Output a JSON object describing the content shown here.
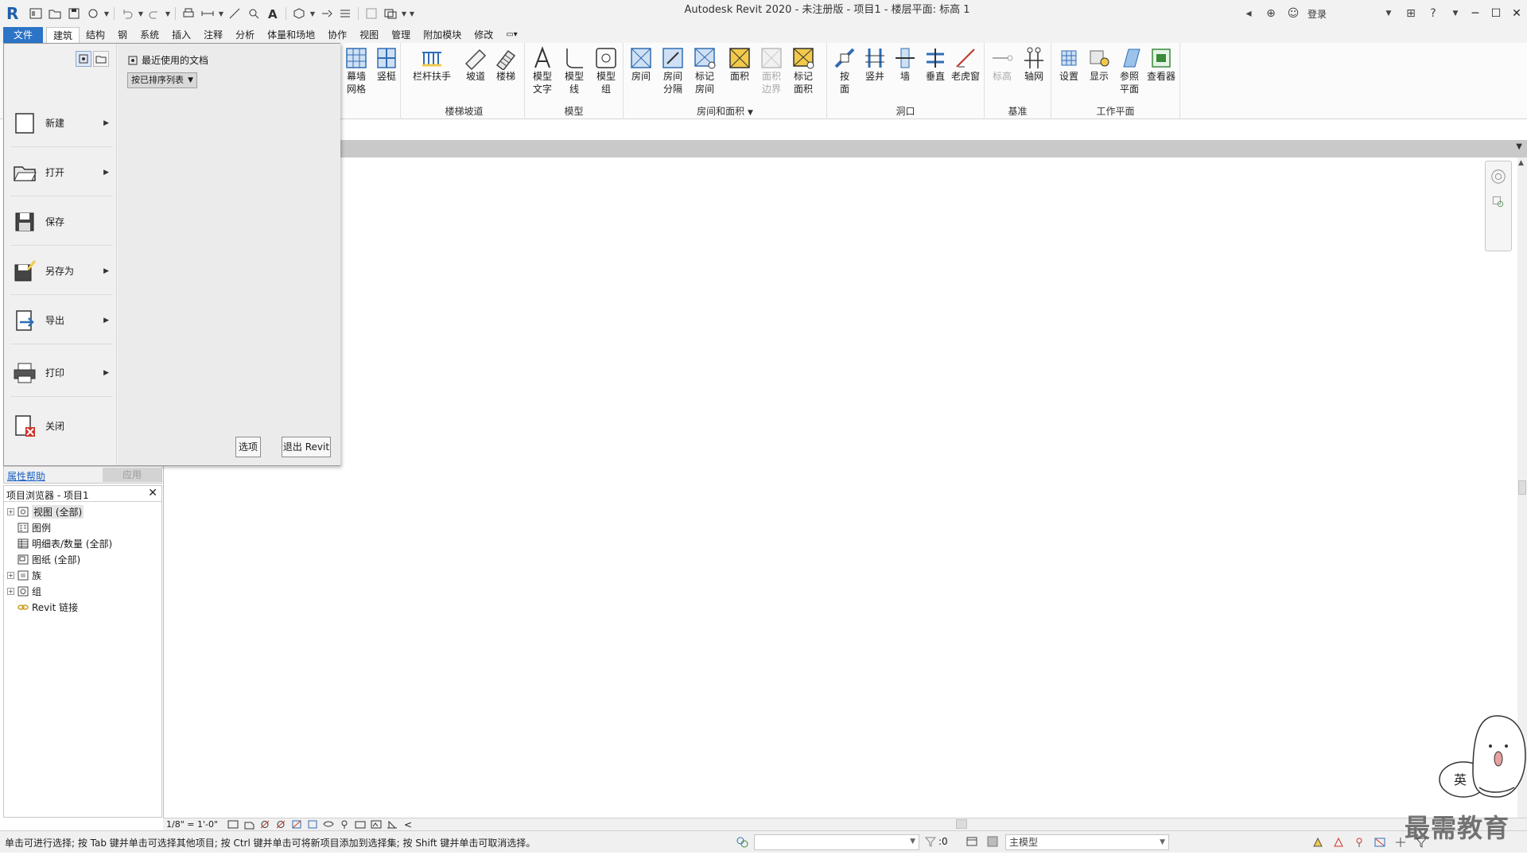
{
  "window": {
    "title": "Autodesk Revit 2020 - 未注册版 - 项目1 - 楼层平面: 标高 1"
  },
  "app_logo": "R",
  "title_right": {
    "sign_in": "登录"
  },
  "tabs": [
    {
      "label": "文件",
      "kind": "file"
    },
    {
      "label": "建筑",
      "kind": "active"
    },
    {
      "label": "结构"
    },
    {
      "label": "钢"
    },
    {
      "label": "系统"
    },
    {
      "label": "插入"
    },
    {
      "label": "注释"
    },
    {
      "label": "分析"
    },
    {
      "label": "体量和场地"
    },
    {
      "label": "协作"
    },
    {
      "label": "视图"
    },
    {
      "label": "管理"
    },
    {
      "label": "附加模块"
    },
    {
      "label": "修改"
    }
  ],
  "ribbon": {
    "curtain": {
      "grid": "幕墙\n网格",
      "mullion": "竖梃"
    },
    "stairs": {
      "label": "楼梯坡道",
      "railing": "栏杆扶手",
      "ramp": "坡道",
      "stair": "楼梯"
    },
    "model": {
      "label": "模型",
      "text": "模型\n文字",
      "line": "模型\n线",
      "group": "模型\n组"
    },
    "room": {
      "label": "房间和面积",
      "room": "房间",
      "separator": "房间\n分隔",
      "tag_room": "标记\n房间",
      "area": "面积",
      "area_boundary": "面积\n边界",
      "tag_area": "标记\n面积"
    },
    "opening": {
      "label": "洞口",
      "by_face": "按\n面",
      "shaft": "竖井",
      "wall": "墙",
      "vertical": "垂直",
      "dormer": "老虎窗"
    },
    "datum": {
      "label": "基准",
      "level": "标高",
      "grid": "轴网"
    },
    "workplane": {
      "label": "工作平面",
      "set": "设置",
      "show": "显示",
      "ref_plane": "参照\n平面",
      "viewer": "查看器"
    }
  },
  "app_menu": {
    "items": [
      {
        "label": "新建",
        "icon": "new-doc-icon",
        "arrow": true
      },
      {
        "label": "打开",
        "icon": "open-folder-icon",
        "arrow": true
      },
      {
        "label": "保存",
        "icon": "save-icon",
        "arrow": false
      },
      {
        "label": "另存为",
        "icon": "save-as-icon",
        "arrow": true
      },
      {
        "label": "导出",
        "icon": "export-icon",
        "arrow": true
      },
      {
        "label": "打印",
        "icon": "print-icon",
        "arrow": true
      },
      {
        "label": "关闭",
        "icon": "close-doc-icon",
        "arrow": false
      }
    ],
    "recent_title": "最近使用的文档",
    "sort_option": "按已排序列表",
    "options_button": "选项",
    "exit_button": "退出 Revit"
  },
  "properties": {
    "help_link": "属性帮助",
    "apply_button": "应用"
  },
  "browser": {
    "title": "项目浏览器 - 项目1",
    "items": [
      {
        "label": "视图 (全部)",
        "expand": "+",
        "icon": "views-icon"
      },
      {
        "label": "图例",
        "expand": "",
        "icon": "legend-icon"
      },
      {
        "label": "明细表/数量 (全部)",
        "expand": "",
        "icon": "schedule-icon"
      },
      {
        "label": "图纸 (全部)",
        "expand": "",
        "icon": "sheet-icon"
      },
      {
        "label": "族",
        "expand": "+",
        "icon": "family-icon"
      },
      {
        "label": "组",
        "expand": "+",
        "icon": "group-icon"
      },
      {
        "label": "Revit 链接",
        "expand": "",
        "icon": "link-icon"
      }
    ]
  },
  "view_control": {
    "scale": "1/8\" = 1'-0\"",
    "collapse": "<"
  },
  "status": {
    "hint": "单击可进行选择; 按 Tab 键并单击可选择其他项目; 按 Ctrl 键并单击可将新项目添加到选择集; 按 Shift 键并单击可取消选择。",
    "selection_count": ":0",
    "main_model": "主模型"
  },
  "watermark": {
    "text": "最需教育",
    "badge": "英"
  },
  "colors": {
    "file_tab": "#2b74c7",
    "link": "#1a5fc2",
    "icon_blue": "#2f6db5",
    "icon_yellow": "#f3c94a"
  }
}
